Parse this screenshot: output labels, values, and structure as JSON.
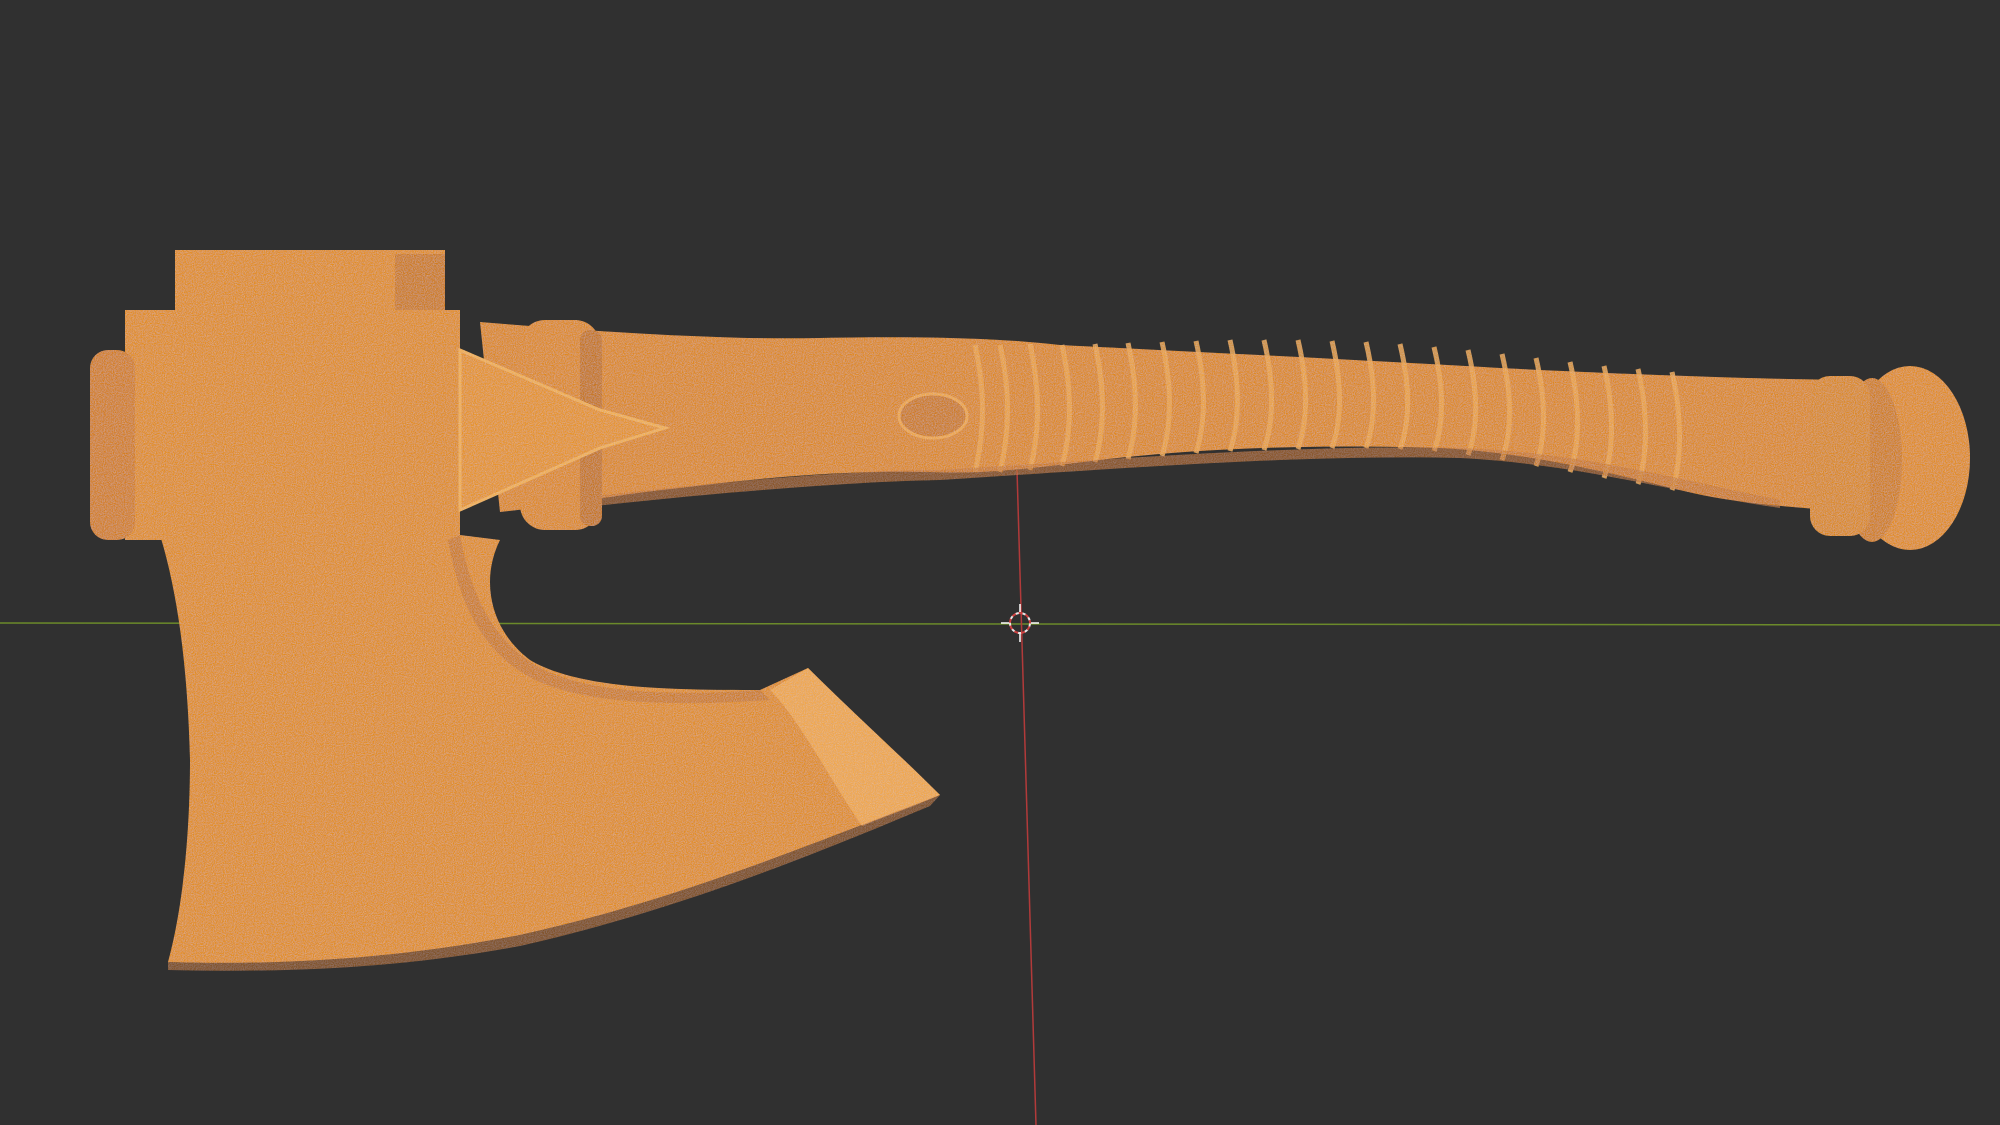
{
  "viewport": {
    "background_color": "#303030",
    "x_axis_color": "#6b8a2a",
    "y_axis_color": "#b23a3a"
  },
  "object": {
    "kind": "axe",
    "selected": true,
    "selection_color": "#e8901e",
    "shade_color": "#c9761a",
    "highlight_color": "#f0a43c"
  },
  "cursor_3d": {
    "icon": "3d-cursor-icon"
  }
}
